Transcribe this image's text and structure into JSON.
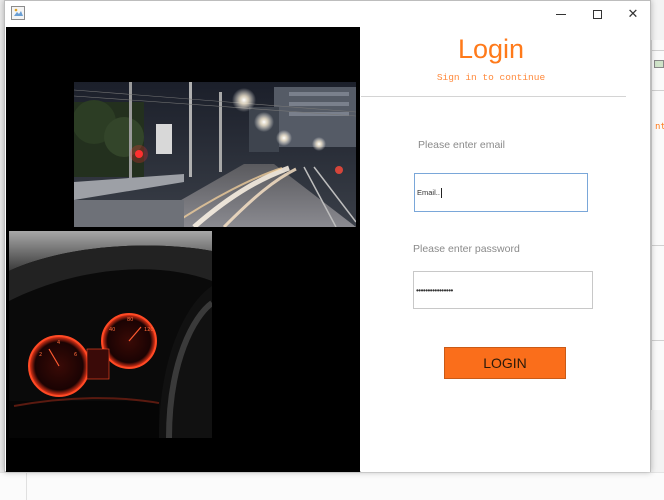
{
  "window": {
    "controls": {
      "close_glyph": "✕"
    }
  },
  "login": {
    "title": "Login",
    "subtitle": "Sign in to continue",
    "email": {
      "label": "Please enter email",
      "value": "Email.."
    },
    "password": {
      "label": "Please enter password",
      "masked_value": "••••••••••••••••"
    },
    "submit_label": "LOGIN"
  },
  "background": {
    "right_fragment_text": "nti"
  },
  "colors": {
    "accent": "#ff7a1a",
    "button": "#fa6e1b",
    "focus_border": "#7aa7d9",
    "left_panel": "#000000"
  },
  "images": [
    {
      "name": "city-night-traffic-photo",
      "description_icon": "photo"
    },
    {
      "name": "car-dashboard-photo",
      "description_icon": "photo"
    }
  ]
}
